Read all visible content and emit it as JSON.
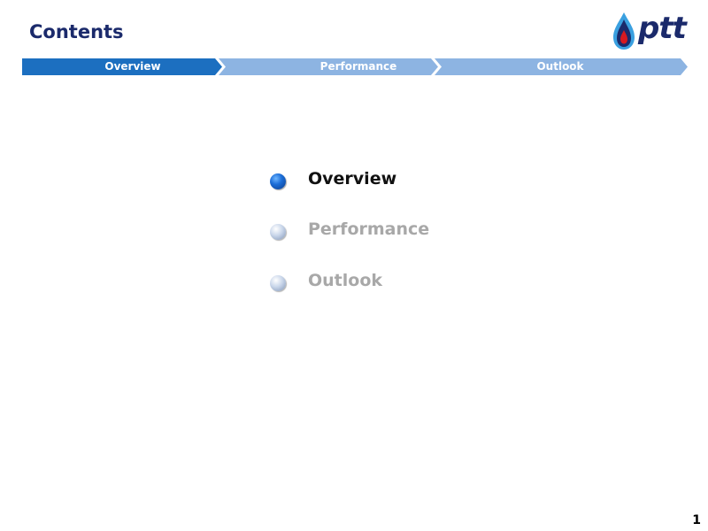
{
  "header": {
    "title": "Contents",
    "logo_text": "ptt"
  },
  "nav": {
    "tabs": [
      {
        "label": "Overview",
        "active": true
      },
      {
        "label": "Performance",
        "active": false
      },
      {
        "label": "Outlook",
        "active": false
      }
    ]
  },
  "agenda": {
    "items": [
      {
        "label": "Overview",
        "active": true
      },
      {
        "label": "Performance",
        "active": false
      },
      {
        "label": "Outlook",
        "active": false
      }
    ]
  },
  "footer": {
    "page_number": "1"
  },
  "colors": {
    "title": "#1b2a6b",
    "nav_active": "#1c6fc0",
    "nav_inactive": "#8db4e2",
    "logo_blue": "#1b2a6b",
    "logo_red": "#d71920",
    "logo_light": "#3aa0e0"
  }
}
